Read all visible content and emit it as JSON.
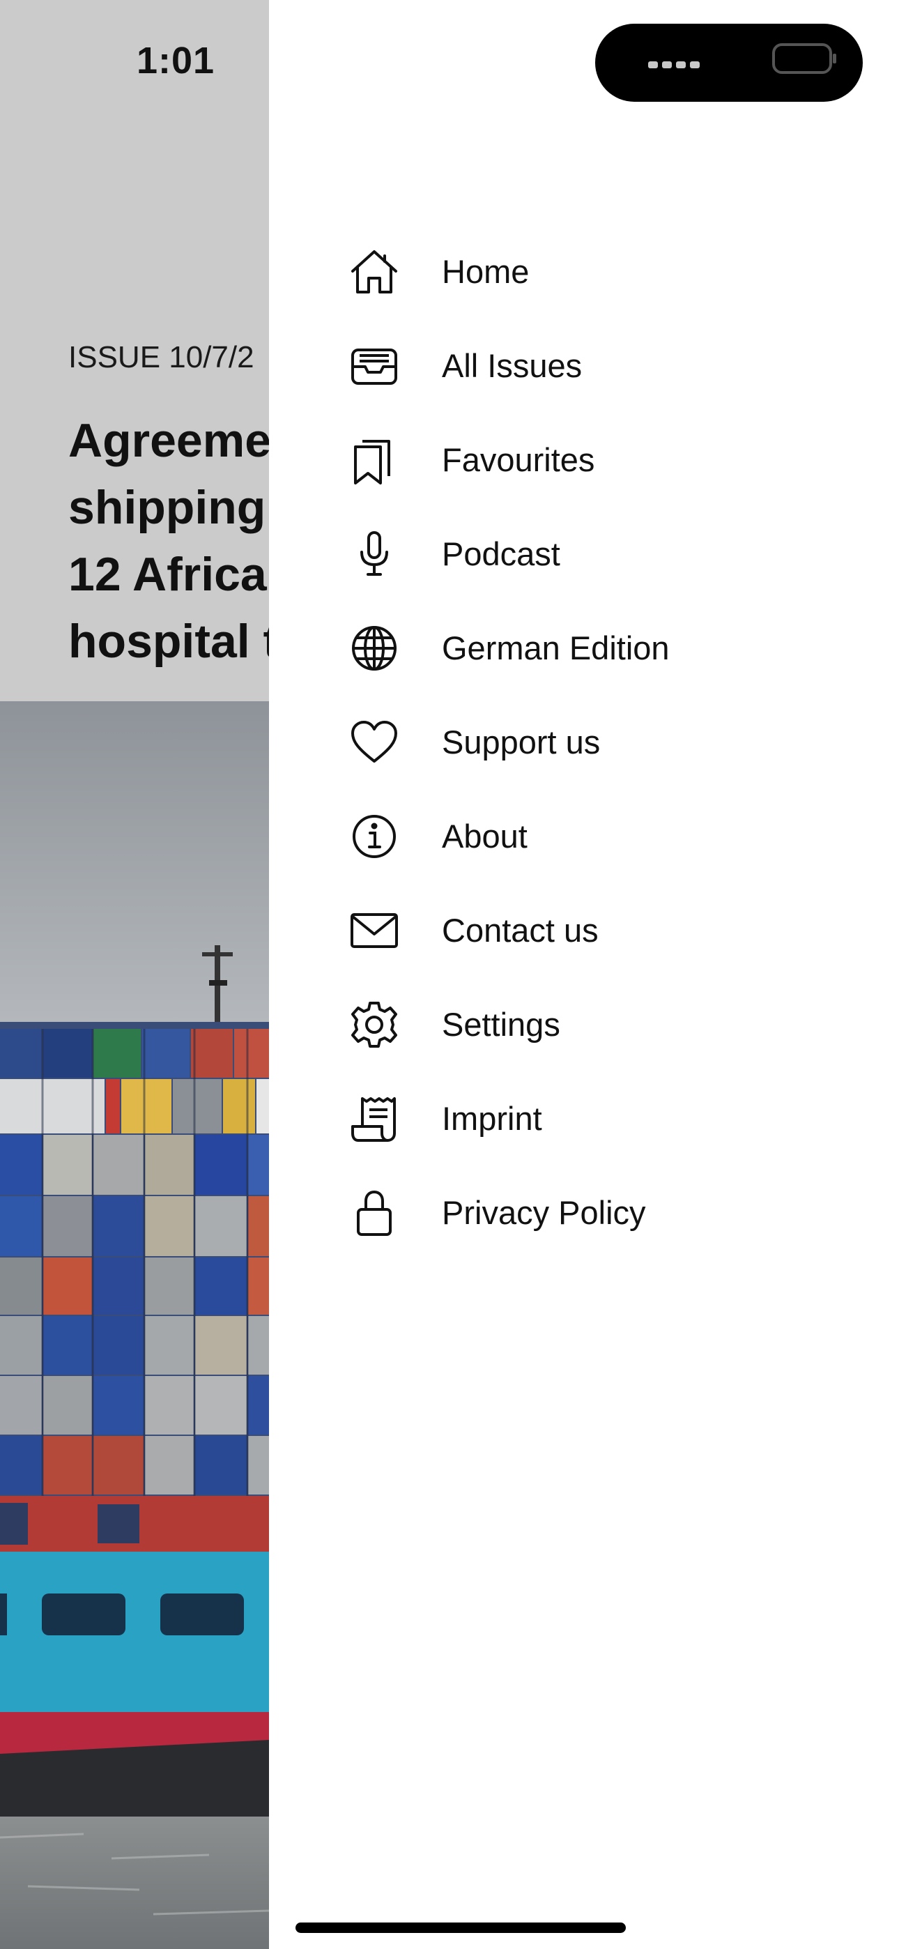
{
  "status_bar": {
    "time": "1:01"
  },
  "article": {
    "issue": "ISSUE 10/7/2",
    "headline_lines": [
      "Agreeme",
      "shipping,",
      "12 Africa",
      "hospital t"
    ]
  },
  "menu": {
    "items": [
      {
        "label": "Home",
        "icon": "home-icon"
      },
      {
        "label": "All Issues",
        "icon": "tray-icon"
      },
      {
        "label": "Favourites",
        "icon": "bookmarks-icon"
      },
      {
        "label": "Podcast",
        "icon": "microphone-icon"
      },
      {
        "label": "German Edition",
        "icon": "globe-icon"
      },
      {
        "label": "Support us",
        "icon": "heart-icon"
      },
      {
        "label": "About",
        "icon": "info-icon"
      },
      {
        "label": "Contact us",
        "icon": "envelope-icon"
      },
      {
        "label": "Settings",
        "icon": "gear-icon"
      },
      {
        "label": "Imprint",
        "icon": "receipt-icon"
      },
      {
        "label": "Privacy Policy",
        "icon": "lock-icon"
      }
    ]
  },
  "colors": {
    "drawer_bg": "#ffffff",
    "header_bg": "#cbcbcb",
    "text": "#111111"
  }
}
